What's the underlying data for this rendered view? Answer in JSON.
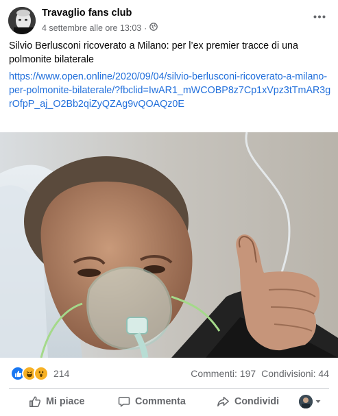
{
  "post": {
    "page_name": "Travaglio fans club",
    "timestamp": "4 settembre alle ore 13:03",
    "separator": "·",
    "audience_icon": "globe-icon",
    "text": "Silvio Berlusconi ricoverato a Milano: per l’ex premier tracce di una polmonite bilaterale",
    "link": "https://www.open.online/2020/09/04/silvio-berlusconi-ricoverato-a-milano-per-polmonite-bilaterale/?fbclid=IwAR1_mWCOBP8z7Cp1xVpz3tTmAR3grOfpP_aj_O2Bb2qiZyQZAg9vQOAQz0E"
  },
  "stats": {
    "reaction_icons": [
      "like-icon",
      "haha-icon",
      "wow-icon"
    ],
    "reaction_count": "214",
    "comments": "Commenti: 197",
    "shares": "Condivisioni: 44"
  },
  "actions": {
    "like": "Mi piace",
    "comment": "Commenta",
    "share": "Condividi"
  },
  "colors": {
    "link": "#216fdb",
    "secondary_text": "#65676b",
    "like_blue": "#1877f2",
    "haha_yellow": "#f7b125"
  }
}
